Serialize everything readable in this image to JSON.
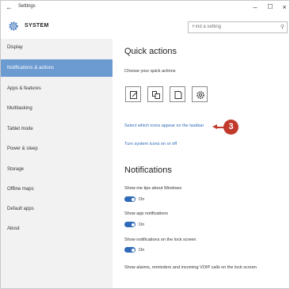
{
  "window": {
    "title": "Settings",
    "controls": {
      "minimize": "–",
      "maximize": "☐",
      "close": "×"
    }
  },
  "header": {
    "title": "SYSTEM",
    "search": {
      "placeholder": "Find a setting"
    }
  },
  "sidebar": {
    "items": [
      {
        "label": "Display"
      },
      {
        "label": "Notifications & actions"
      },
      {
        "label": "Apps & features"
      },
      {
        "label": "Multitasking"
      },
      {
        "label": "Tablet mode"
      },
      {
        "label": "Power & sleep"
      },
      {
        "label": "Storage"
      },
      {
        "label": "Offline maps"
      },
      {
        "label": "Default apps"
      },
      {
        "label": "About"
      }
    ],
    "active_index": 1
  },
  "main": {
    "quick_actions": {
      "heading": "Quick actions",
      "subheading": "Choose your quick actions",
      "tiles": [
        {
          "icon": "note-icon"
        },
        {
          "icon": "tablet-mode-icon"
        },
        {
          "icon": "connect-icon"
        },
        {
          "icon": "settings-icon"
        }
      ],
      "link_taskbar_icons": "Select which icons appear on the taskbar",
      "link_system_icons": "Turn system icons on or off"
    },
    "notifications": {
      "heading": "Notifications",
      "settings": [
        {
          "label": "Show me tips about Windows",
          "state": "On"
        },
        {
          "label": "Show app notifications",
          "state": "On"
        },
        {
          "label": "Show notifications on the lock screen",
          "state": "On"
        },
        {
          "label": "Show alarms, reminders and incoming VOIP calls on the lock screen"
        }
      ]
    }
  },
  "callout": {
    "number": "3",
    "color": "#c0392b"
  },
  "colors": {
    "accent": "#6b9bd1",
    "link": "#2f6bb8",
    "toggle_on": "#2f6bb8"
  }
}
